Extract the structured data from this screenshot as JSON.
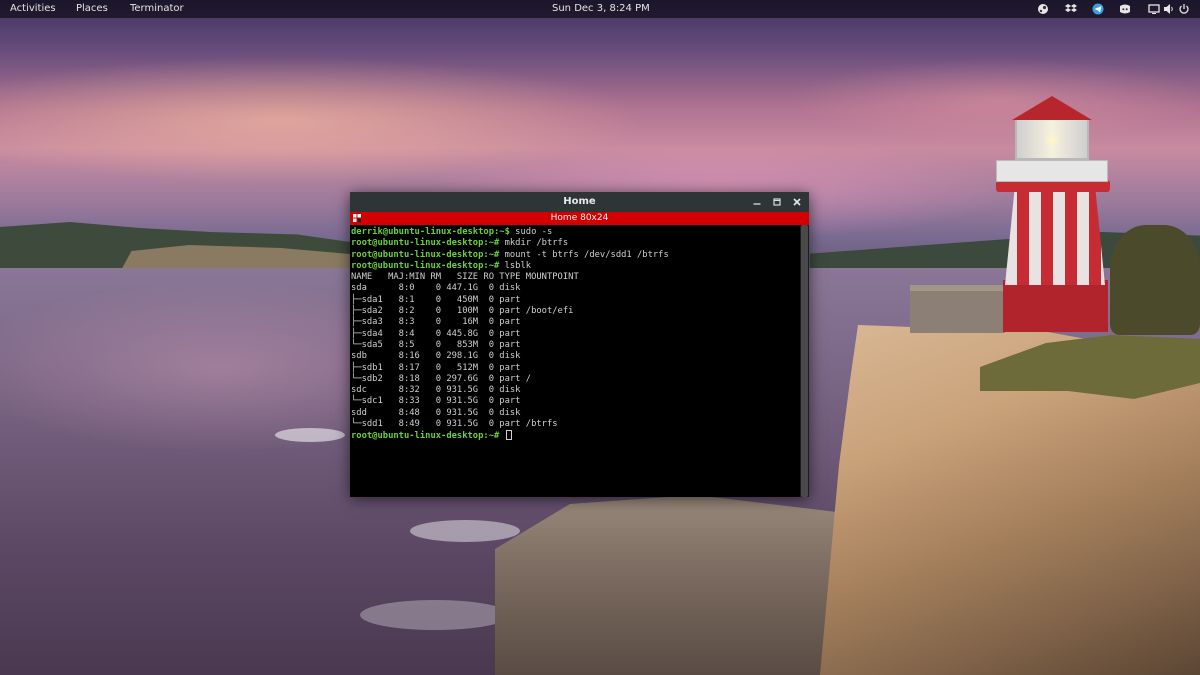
{
  "topbar": {
    "activities": "Activities",
    "places": "Places",
    "app": "Terminator",
    "clock": "Sun Dec  3,  8:24 PM",
    "tray_icons": [
      "steam-icon",
      "dropbox-icon",
      "telegram-icon",
      "discord-icon",
      "screen-icon",
      "volume-icon",
      "power-icon"
    ]
  },
  "terminal": {
    "title": "Home",
    "tab_label": "Home 80x24",
    "tab_color": "#d40000",
    "prompt_color": "#6ccf3a",
    "lines": [
      {
        "prompt": "derrik@ubuntu-linux-desktop:~$",
        "text": " sudo -s"
      },
      {
        "prompt": "root@ubuntu-linux-desktop:~#",
        "text": " mkdir /btrfs"
      },
      {
        "prompt": "root@ubuntu-linux-desktop:~#",
        "text": " mount -t btrfs /dev/sdd1 /btrfs"
      },
      {
        "prompt": "root@ubuntu-linux-desktop:~#",
        "text": " lsblk"
      },
      {
        "prompt": "",
        "text": "NAME   MAJ:MIN RM   SIZE RO TYPE MOUNTPOINT"
      },
      {
        "prompt": "",
        "text": "sda      8:0    0 447.1G  0 disk"
      },
      {
        "prompt": "",
        "text": "├─sda1   8:1    0   450M  0 part"
      },
      {
        "prompt": "",
        "text": "├─sda2   8:2    0   100M  0 part /boot/efi"
      },
      {
        "prompt": "",
        "text": "├─sda3   8:3    0    16M  0 part"
      },
      {
        "prompt": "",
        "text": "├─sda4   8:4    0 445.8G  0 part"
      },
      {
        "prompt": "",
        "text": "└─sda5   8:5    0   853M  0 part"
      },
      {
        "prompt": "",
        "text": "sdb      8:16   0 298.1G  0 disk"
      },
      {
        "prompt": "",
        "text": "├─sdb1   8:17   0   512M  0 part"
      },
      {
        "prompt": "",
        "text": "└─sdb2   8:18   0 297.6G  0 part /"
      },
      {
        "prompt": "",
        "text": "sdc      8:32   0 931.5G  0 disk"
      },
      {
        "prompt": "",
        "text": "└─sdc1   8:33   0 931.5G  0 part"
      },
      {
        "prompt": "",
        "text": "sdd      8:48   0 931.5G  0 disk"
      },
      {
        "prompt": "",
        "text": "└─sdd1   8:49   0 931.5G  0 part /btrfs"
      },
      {
        "prompt": "root@ubuntu-linux-desktop:~#",
        "text": " "
      }
    ]
  }
}
